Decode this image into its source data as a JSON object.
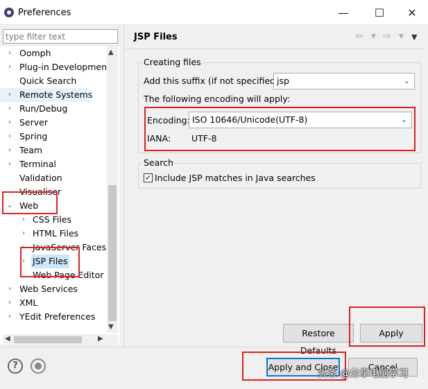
{
  "window": {
    "title": "Preferences",
    "controls": {
      "minimize": "—",
      "maximize": "☐",
      "close": "✕"
    }
  },
  "sidebar": {
    "filter_placeholder": "type filter text",
    "items": [
      {
        "label": "Oomph",
        "expandable": true
      },
      {
        "label": "Plug-in Development",
        "expandable": true
      },
      {
        "label": "Quick Search",
        "expandable": false
      },
      {
        "label": "Remote Systems",
        "expandable": true
      },
      {
        "label": "Run/Debug",
        "expandable": true
      },
      {
        "label": "Server",
        "expandable": true
      },
      {
        "label": "Spring",
        "expandable": true
      },
      {
        "label": "Team",
        "expandable": true
      },
      {
        "label": "Terminal",
        "expandable": true
      },
      {
        "label": "Validation",
        "expandable": false
      },
      {
        "label": "Visualiser",
        "expandable": false
      },
      {
        "label": "Web",
        "expandable": true,
        "expanded": true
      },
      {
        "label": "CSS Files",
        "expandable": true
      },
      {
        "label": "HTML Files",
        "expandable": true
      },
      {
        "label": "JavaServer Faces T",
        "expandable": true
      },
      {
        "label": "JSP Files",
        "expandable": true,
        "selected": true
      },
      {
        "label": "Web Page Editor",
        "expandable": false
      },
      {
        "label": "Web Services",
        "expandable": true
      },
      {
        "label": "XML",
        "expandable": true
      },
      {
        "label": "YEdit Preferences",
        "expandable": true
      }
    ]
  },
  "page": {
    "title": "JSP Files",
    "creating_group": {
      "title": "Creating files",
      "suffix_label": "Add this suffix (if not specified):",
      "suffix_value": "jsp",
      "encoding_intro": "The following encoding will apply:",
      "encoding_label": "Encoding:",
      "encoding_value": "ISO 10646/Unicode(UTF-8)",
      "iana_label": "IANA:",
      "iana_value": "UTF-8"
    },
    "search_group": {
      "title": "Search",
      "include_label": "Include JSP matches in Java searches",
      "include_checked": true
    },
    "restore_defaults_label": "Restore Defaults",
    "apply_label": "Apply"
  },
  "footer": {
    "help_icon": "?",
    "apply_close_label": "Apply and Close",
    "cancel_label": "Cancel"
  },
  "watermark": "头条 @分享电脑学习",
  "colors": {
    "highlight_red": "#e02020",
    "selection_blue": "#cce8ff",
    "default_button_border": "#0078d7"
  }
}
